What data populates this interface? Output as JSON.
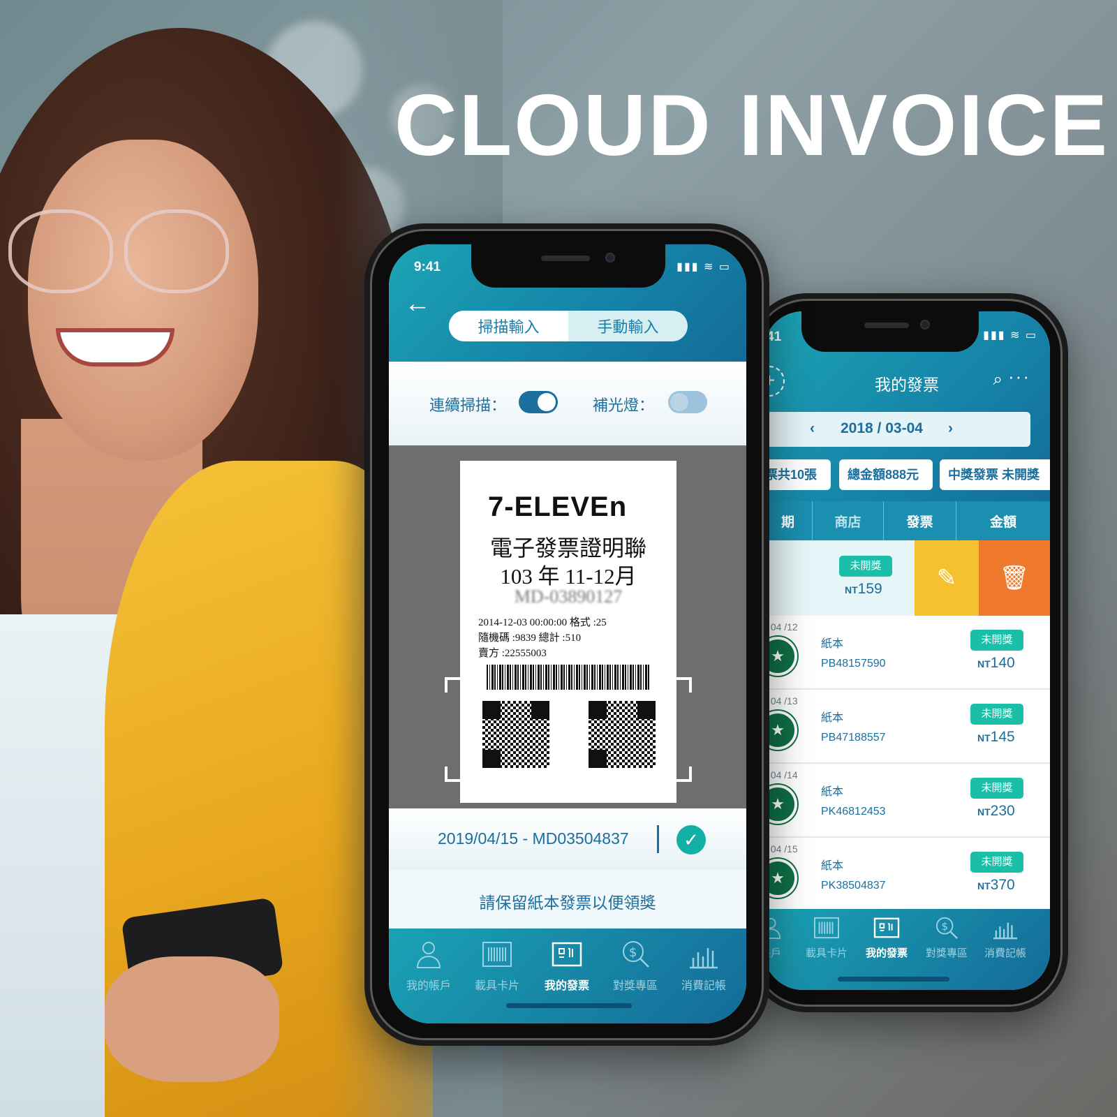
{
  "headline": "CLOUD INVOICE",
  "colors": {
    "accent_teal": "#1ca4b5",
    "accent_blue": "#146b98",
    "badge_green": "#1bbfa8",
    "edit_yellow": "#f5c12e",
    "delete_orange": "#ef7a2d"
  },
  "front_phone": {
    "status_time": "9:41",
    "status_icons": "▮▮▮ ≋ ▭",
    "back_icon": "←",
    "segments": [
      "掃描輸入",
      "手動輸入"
    ],
    "active_segment": 0,
    "toggles": [
      {
        "label": "連續掃描：",
        "on": true
      },
      {
        "label": "補光燈：",
        "on": false
      }
    ],
    "receipt": {
      "brand": "7-ELEVEn",
      "title": "電子發票證明聯",
      "period": "103 年 11-12月",
      "number": "MD-03890127",
      "line1": "2014-12-03 00:00:00  格式 :25",
      "line2": "隨機碼 :9839         總計 :510",
      "line3": "賣方 :22555003"
    },
    "result": "2019/04/15 - MD03504837",
    "hint": "請保留紙本發票以便領獎",
    "tabs": [
      {
        "label": "我的帳戶",
        "icon": "user-icon"
      },
      {
        "label": "載具卡片",
        "icon": "barcode-card-icon"
      },
      {
        "label": "我的發票",
        "icon": "invoice-icon"
      },
      {
        "label": "對獎專區",
        "icon": "prize-search-icon"
      },
      {
        "label": "消費記帳",
        "icon": "bar-chart-icon"
      }
    ],
    "active_tab": 2
  },
  "back_phone": {
    "status_time": "41",
    "title": "我的發票",
    "date_range": "2018 / 03-04",
    "prev": "‹",
    "next": "›",
    "chips": [
      "票共10張",
      "總金額888元",
      "中獎發票 未開獎"
    ],
    "columns": [
      "期",
      "商店",
      "發票",
      "金額"
    ],
    "highlight_row": {
      "badge": "未開獎",
      "currency": "NT",
      "amount": "159"
    },
    "rows": [
      {
        "date": "/ 04 /12",
        "kind": "紙本",
        "number": "PB48157590",
        "badge": "未開獎",
        "currency": "NT",
        "amount": "140"
      },
      {
        "date": "/ 04 /13",
        "kind": "紙本",
        "number": "PB47188557",
        "badge": "未開獎",
        "currency": "NT",
        "amount": "145"
      },
      {
        "date": "/ 04 /14",
        "kind": "紙本",
        "number": "PK46812453",
        "badge": "未開獎",
        "currency": "NT",
        "amount": "230"
      },
      {
        "date": "/ 04 /15",
        "kind": "紙本",
        "number": "PK38504837",
        "badge": "未開獎",
        "currency": "NT",
        "amount": "370"
      }
    ],
    "tabs": [
      {
        "label": "帳戶",
        "icon": "user-icon"
      },
      {
        "label": "載具卡片",
        "icon": "barcode-card-icon"
      },
      {
        "label": "我的發票",
        "icon": "invoice-icon"
      },
      {
        "label": "對獎專區",
        "icon": "prize-search-icon"
      },
      {
        "label": "消費記帳",
        "icon": "bar-chart-icon"
      }
    ],
    "active_tab": 2
  }
}
